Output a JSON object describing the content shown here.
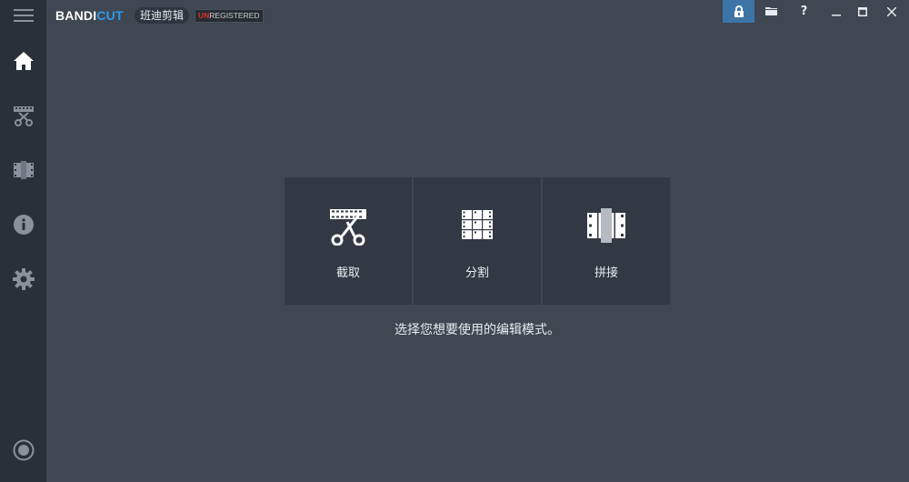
{
  "app": {
    "logo_part1": "BANDI",
    "logo_part2": "CUT",
    "name_cn": "班迪剪辑",
    "unreg_prefix": "UN",
    "unreg_rest": "REGISTERED"
  },
  "window_controls": [
    "lock-icon",
    "folder-icon",
    "help-icon",
    "minimize-icon",
    "maximize-icon",
    "close-icon"
  ],
  "help_glyph": "?",
  "sidebar": {
    "items": [
      {
        "icon": "home-icon"
      },
      {
        "icon": "trim-icon"
      },
      {
        "icon": "join-icon"
      },
      {
        "icon": "info-icon"
      },
      {
        "icon": "settings-icon"
      },
      {
        "icon": "record-icon"
      }
    ]
  },
  "modes": [
    {
      "label": "截取",
      "icon": "trim-scissors-icon"
    },
    {
      "label": "分割",
      "icon": "split-grid-icon"
    },
    {
      "label": "拼接",
      "icon": "join-film-icon"
    }
  ],
  "hint": "选择您想要使用的编辑模式。",
  "colors": {
    "background": "#3f4753",
    "sidebar": "#2a3039",
    "tile": "#323944",
    "accent": "#2f9be8",
    "lock_active": "#3d74a6"
  }
}
